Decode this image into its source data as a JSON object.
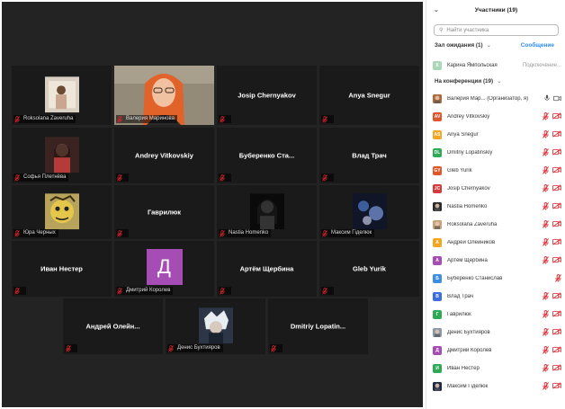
{
  "gallery": {
    "row1": [
      {
        "label": "Roksolana Zaveruha",
        "type": "photo"
      },
      {
        "label": "Валерия Маринова",
        "type": "photo",
        "active": true
      },
      {
        "name": "Josip Chernyakov"
      },
      {
        "name": "Anya Snegur"
      }
    ],
    "row2": [
      {
        "label": "Софья Плетнёва",
        "type": "photo"
      },
      {
        "name": "Andrey Vitkovskiy"
      },
      {
        "name": "Буберенко  Ста..."
      },
      {
        "name": "Влад Трач"
      }
    ],
    "row3": [
      {
        "label": "Юра Черных",
        "type": "photo"
      },
      {
        "name": "Гаврилюк"
      },
      {
        "label": "Nastia Homenko",
        "type": "photo"
      },
      {
        "label": "Максим Гiделюк",
        "type": "photo"
      }
    ],
    "row4": [
      {
        "name": "Иван Нестер"
      },
      {
        "label": "Дмитрий Королев",
        "avatar": "Д",
        "avatar_color": "#a64db5"
      },
      {
        "name": "Артём Щербина"
      },
      {
        "name": "Gleb Yurik"
      }
    ],
    "row5": [
      {
        "name": "Андрей  Олейн..."
      },
      {
        "label": "Денис Бухтияров",
        "type": "photo"
      },
      {
        "name": "Dmitriy  Lopatin..."
      }
    ]
  },
  "panel": {
    "title": "Участники (19)",
    "search_placeholder": "Найти участника",
    "waiting_label": "Зал ожидания (1)",
    "message_label": "Сообщение",
    "waiting": {
      "initial": "К",
      "name": "Карина Ямпольская",
      "status": "Подключение...",
      "color": "#a9d8b8"
    },
    "conference_label": "На конференции (19)",
    "participants": [
      {
        "name": "Валерия Мар... (Организатор, я)",
        "initial": "",
        "color": "#b06a3a",
        "photo": true,
        "host": true
      },
      {
        "name": "Andrey Vitkovskiy",
        "initial": "AV",
        "color": "#e0562b"
      },
      {
        "name": "Anya Snegur",
        "initial": "AS",
        "color": "#f2a623"
      },
      {
        "name": "Dmitriy Lopatinskiy",
        "initial": "DL",
        "color": "#2eaa55"
      },
      {
        "name": "Gleb Yurik",
        "initial": "GY",
        "color": "#e0562b"
      },
      {
        "name": "Josip Chernyakov",
        "initial": "JC",
        "color": "#d63b3b"
      },
      {
        "name": "Nastia Homenko",
        "initial": "",
        "color": "#2a2a2a",
        "photo": true
      },
      {
        "name": "Roksolana Zaveruha",
        "initial": "",
        "color": "#c8a27a",
        "photo": true
      },
      {
        "name": "Андрей Олейников",
        "initial": "А",
        "color": "#f2a623"
      },
      {
        "name": "Артём Щербина",
        "initial": "А",
        "color": "#a64db5"
      },
      {
        "name": "Буберенко Станислав",
        "initial": "Б",
        "color": "#3b8ee0",
        "nocam": true
      },
      {
        "name": "Влад Трач",
        "initial": "В",
        "color": "#3b6fe0"
      },
      {
        "name": "Гаврилюк",
        "initial": "Г",
        "color": "#2eaa55"
      },
      {
        "name": "Денис Бухтияров",
        "initial": "",
        "color": "#8899aa",
        "photo": true
      },
      {
        "name": "Дмитрий Королев",
        "initial": "Д",
        "color": "#a64db5"
      },
      {
        "name": "Иван Нестер",
        "initial": "И",
        "color": "#2eaa55"
      },
      {
        "name": "Максим Гiделюк",
        "initial": "",
        "color": "#1c2a4a",
        "photo": true
      }
    ]
  }
}
